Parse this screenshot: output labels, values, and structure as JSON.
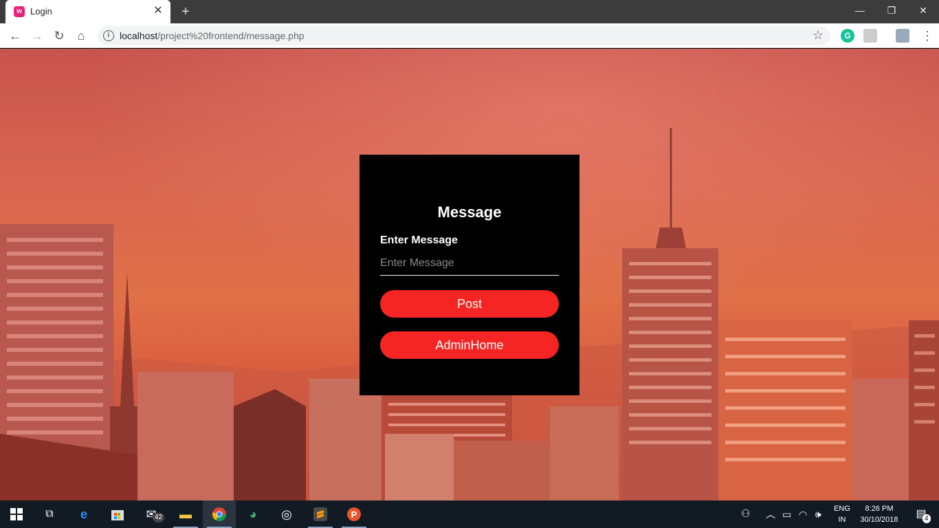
{
  "browser": {
    "tab_title": "Login",
    "tab_favicon": "w",
    "url_host": "localhost",
    "url_path": "/project%20frontend/message.php",
    "icons": [
      "wamp-favicon",
      "back-icon",
      "forward-icon",
      "reload-icon",
      "home-icon",
      "info-icon",
      "star-icon",
      "grammarly-icon",
      "pdf-icon",
      "extension-icon",
      "menu-icon"
    ]
  },
  "card": {
    "title": "Message",
    "field_label": "Enter Message",
    "input_placeholder": "Enter Message",
    "input_value": "",
    "post_button": "Post",
    "admin_home_button": "AdminHome"
  },
  "colors": {
    "card_bg": "#000000",
    "button_bg": "#f52523",
    "background_tint": "#d86650"
  },
  "taskbar": {
    "mail_badge": "42",
    "language_line1": "ENG",
    "language_line2": "IN",
    "time": "8:26 PM",
    "date": "30/10/2018",
    "notifications_badge": "4",
    "icons": [
      "windows-start-icon",
      "task-view-icon",
      "edge-icon",
      "store-icon",
      "mail-icon",
      "file-explorer-icon",
      "chrome-icon",
      "idm-icon",
      "steam-like-icon",
      "sublime-icon",
      "p-app-icon",
      "people-icon",
      "chevron-up-icon",
      "battery-icon",
      "wifi-icon",
      "volume-icon",
      "action-center-icon"
    ]
  }
}
